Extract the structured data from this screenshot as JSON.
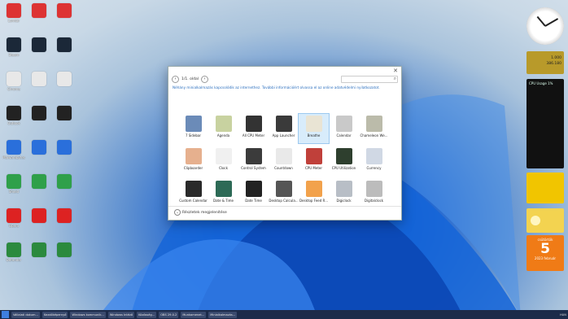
{
  "window": {
    "page_indicator": "1/1. oldal",
    "info_text": "Néhány minialkalmazás kapcsolódik az internethez. További információért olvassa el az online adatvédelmi nyilatkozatot.",
    "details_label": "Részletek megjelenítése",
    "gadgets": [
      {
        "name": "7 Sidebar",
        "color": "#6b8bb8"
      },
      {
        "name": "Agenda",
        "color": "#c8d2a0"
      },
      {
        "name": "All CPU Meter",
        "color": "#333333"
      },
      {
        "name": "App Launcher",
        "color": "#3a3a3a"
      },
      {
        "name": "Breathe",
        "color": "#e9e4d4",
        "selected": true
      },
      {
        "name": "Calendar",
        "color": "#c9c9c9"
      },
      {
        "name": "Chameleon We...",
        "color": "#bbbbaa"
      },
      {
        "name": "Clipboarder",
        "color": "#e6b08e"
      },
      {
        "name": "Clock",
        "color": "#f0f0f0"
      },
      {
        "name": "Control System",
        "color": "#3b3b3b"
      },
      {
        "name": "Countdown",
        "color": "#e9e9e9"
      },
      {
        "name": "CPU Meter",
        "color": "#c0403a"
      },
      {
        "name": "CPU Utilization",
        "color": "#2e3f2e"
      },
      {
        "name": "Currency",
        "color": "#d0d8e4"
      },
      {
        "name": "Custom Calendar",
        "color": "#2a2a2a"
      },
      {
        "name": "Date & Time",
        "color": "#2d6a56"
      },
      {
        "name": "Date Time",
        "color": "#222222"
      },
      {
        "name": "Desktop Calcula...",
        "color": "#555555"
      },
      {
        "name": "Desktop Feed R...",
        "color": "#f2a24c"
      },
      {
        "name": "Digiclock",
        "color": "#b8bec6"
      },
      {
        "name": "Digitalclock",
        "color": "#bcbcbc"
      }
    ]
  },
  "desktop_icons": [
    {
      "label": "Lomtár",
      "color": "#d33"
    },
    {
      "label": "Steam",
      "color": "#1b2838"
    },
    {
      "label": "Chrome",
      "color": "#e8e8e8"
    },
    {
      "label": "Outlook",
      "color": "#222"
    },
    {
      "label": "Malwarebytes",
      "color": "#2a6fdb"
    },
    {
      "label": "Shield",
      "color": "#2fa04a"
    },
    {
      "label": "Opera",
      "color": "#d22"
    },
    {
      "label": "Defender",
      "color": "#2b8a3e"
    }
  ],
  "sidebar": {
    "stock_values": [
      "1.000",
      "386.180"
    ],
    "cpu_title": "CPU Usage 1%",
    "calendar": {
      "day": "5",
      "month": "csütörtök",
      "year": "2023 február"
    }
  },
  "taskbar": {
    "items": [
      "Vállalati dokum...",
      "Kezdőképernyő",
      "Windows kommunik...",
      "Windows Intéző",
      "Közösség...",
      "OBS 29.0.2",
      "Munkamenet...",
      "Minialkalmazás..."
    ],
    "tray_text": "HUN"
  }
}
